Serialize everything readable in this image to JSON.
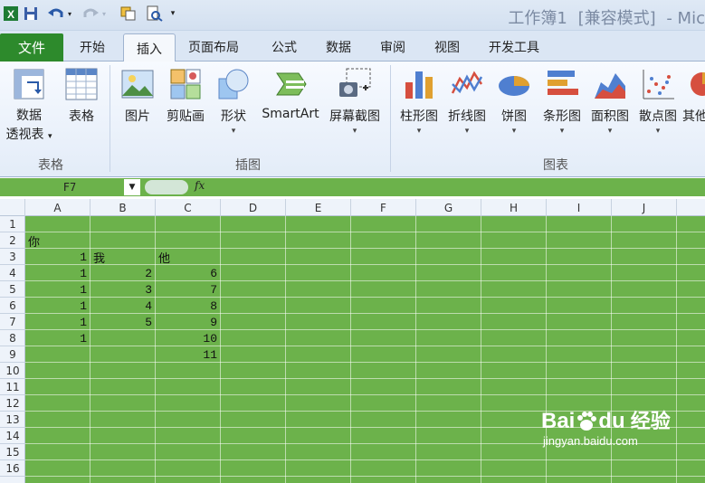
{
  "title": {
    "workbook": "工作簿1",
    "mode": "[兼容模式]",
    "app": "- Mic"
  },
  "tabs": {
    "file": "文件",
    "home": "开始",
    "insert": "插入",
    "page_layout": "页面布局",
    "formulas": "公式",
    "data": "数据",
    "review": "审阅",
    "view": "视图",
    "developer": "开发工具"
  },
  "ribbon": {
    "pivot_table_line1": "数据",
    "pivot_table_line2": "透视表",
    "table": "表格",
    "picture": "图片",
    "clipart": "剪贴画",
    "shapes": "形状",
    "smartart": "SmartArt",
    "screenshot": "屏幕截图",
    "column_chart": "柱形图",
    "line_chart": "折线图",
    "pie_chart": "饼图",
    "bar_chart": "条形图",
    "area_chart": "面积图",
    "scatter_chart": "散点图",
    "other_chart": "其他",
    "group_tables": "表格",
    "group_illustrations": "插图",
    "group_charts": "图表"
  },
  "formula_bar": {
    "name_box": "F7",
    "fx": "fx"
  },
  "sheet": {
    "columns": [
      "A",
      "B",
      "C",
      "D",
      "E",
      "F",
      "G",
      "H",
      "I",
      "J"
    ],
    "rows": [
      "1",
      "2",
      "3",
      "4",
      "5",
      "6",
      "7",
      "8",
      "9",
      "10",
      "11",
      "12",
      "13",
      "14",
      "15",
      "16"
    ],
    "cells": {
      "A2": "你",
      "A3": "1",
      "B3": "我",
      "C3": "他",
      "A4": "1",
      "B4": "2",
      "C4": "6",
      "A5": "1",
      "B5": "3",
      "C5": "7",
      "A6": "1",
      "B6": "4",
      "C6": "8",
      "A7": "1",
      "B7": "5",
      "C7": "9",
      "A8": "1",
      "C8": "10",
      "C9": "11"
    }
  },
  "watermark": {
    "brand": "Bai",
    "brand2": "du",
    "service": "经验",
    "url": "jingyan.baidu.com"
  },
  "colors": {
    "sheet_bg": "#6cb24b",
    "file_tab": "#2d8a2c"
  }
}
